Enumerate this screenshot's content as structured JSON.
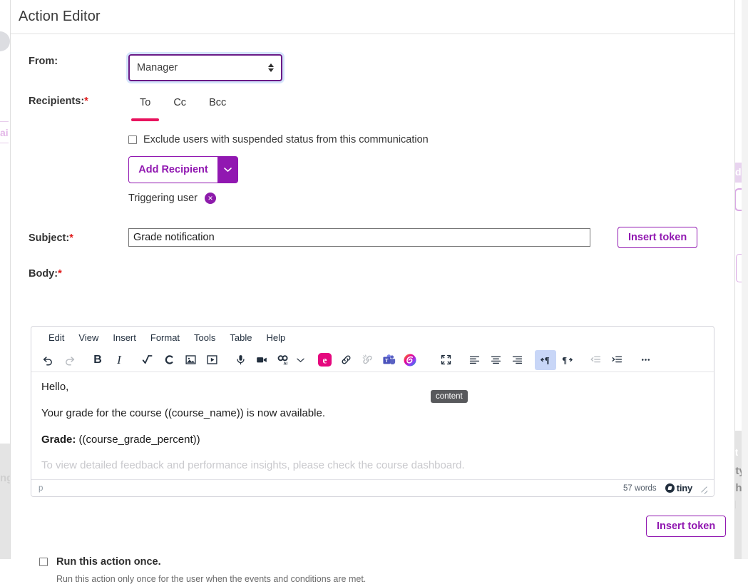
{
  "header": {
    "title": "Action Editor"
  },
  "form": {
    "from": {
      "label": "From:",
      "value": "Manager"
    },
    "recipients": {
      "label": "Recipients:",
      "required_mark": "*",
      "tabs": [
        {
          "label": "To",
          "active": true
        },
        {
          "label": "Cc",
          "active": false
        },
        {
          "label": "Bcc",
          "active": false
        }
      ],
      "exclude_checkbox_label": "Exclude users with suspended status from this communication",
      "exclude_checked": false,
      "add_recipient_label": "Add Recipient",
      "chips": [
        {
          "label": "Triggering user",
          "remove_glyph": "✕"
        }
      ]
    },
    "subject": {
      "label": "Subject:",
      "required_mark": "*",
      "value": "Grade notification",
      "placeholder": ""
    },
    "body": {
      "label": "Body:",
      "required_mark": "*"
    },
    "insert_token_label": "Insert token",
    "insert_token_label_lower": "Insert token"
  },
  "editor": {
    "menubar": [
      "Edit",
      "View",
      "Insert",
      "Format",
      "Tools",
      "Table",
      "Help"
    ],
    "toolbar": [
      {
        "name": "undo-icon",
        "title": "Undo",
        "disabled": false
      },
      {
        "name": "redo-icon",
        "title": "Redo",
        "disabled": true
      },
      {
        "name": "bold-icon",
        "title": "Bold",
        "disabled": false
      },
      {
        "name": "italic-icon",
        "title": "Italic",
        "disabled": false
      },
      {
        "name": "math-equation-icon",
        "title": "Equation",
        "disabled": false
      },
      {
        "name": "chemistry-icon",
        "title": "Chemistry",
        "disabled": false
      },
      {
        "name": "insert-image-icon",
        "title": "Insert image",
        "disabled": false
      },
      {
        "name": "insert-video-icon",
        "title": "Insert video",
        "disabled": false
      },
      {
        "name": "microphone-icon",
        "title": "Record audio",
        "disabled": false
      },
      {
        "name": "video-camera-icon",
        "title": "Record video",
        "disabled": false
      },
      {
        "name": "ai-assist-icon",
        "title": "AI assist",
        "disabled": false
      },
      {
        "name": "chevron-down-icon",
        "title": "More AI options",
        "disabled": false
      },
      {
        "name": "embed-e-icon",
        "title": "Embed",
        "disabled": false
      },
      {
        "name": "link-icon",
        "title": "Insert link",
        "disabled": false
      },
      {
        "name": "unlink-icon",
        "title": "Remove link",
        "disabled": true
      },
      {
        "name": "microsoft-teams-icon",
        "title": "Teams",
        "disabled": false
      },
      {
        "name": "swirl-icon",
        "title": "Integration",
        "disabled": false
      },
      {
        "name": "fullscreen-icon",
        "title": "Fullscreen",
        "disabled": false
      },
      {
        "name": "align-left-icon",
        "title": "Align left",
        "disabled": false
      },
      {
        "name": "align-center-icon",
        "title": "Align center",
        "disabled": false
      },
      {
        "name": "align-right-icon",
        "title": "Align right",
        "disabled": false
      },
      {
        "name": "ltr-icon",
        "title": "Left to right",
        "disabled": false,
        "active": true
      },
      {
        "name": "rtl-icon",
        "title": "Right to left",
        "disabled": false
      },
      {
        "name": "outdent-icon",
        "title": "Decrease indent",
        "disabled": true
      },
      {
        "name": "indent-icon",
        "title": "Increase indent",
        "disabled": false
      },
      {
        "name": "more-options-icon",
        "title": "More",
        "disabled": false
      }
    ],
    "content": [
      {
        "text": "Hello,",
        "bold_prefix": ""
      },
      {
        "text": "Your grade for the course ((course_name)) is now available.",
        "bold_prefix": ""
      },
      {
        "bold_prefix": "Grade:",
        "text": " ((course_grade_percent))"
      },
      {
        "text": "To view detailed feedback and performance insights, please check the course dashboard.",
        "bold_prefix": ""
      }
    ],
    "status": {
      "path": "p",
      "word_count": "57 words",
      "brand": "tiny"
    },
    "tooltip": "content"
  },
  "run_once": {
    "label": "Run this action once.",
    "checked": false,
    "help": "Run this action only once for the user when the events and conditions are met."
  },
  "background": {
    "left_text": "ai",
    "left_grey_text": "ng",
    "right_chip_text": "d",
    "right_text_1": "ct",
    "right_text_2": "lity",
    "right_text_3": "ch",
    "right_text_4": "d"
  },
  "colors": {
    "accent_purple": "#9118b1",
    "accent_pink": "#e8135e",
    "required_red": "#e01b1b",
    "focus_blue": "#d5e4fb",
    "toolbar_active": "#c8d6f7"
  }
}
